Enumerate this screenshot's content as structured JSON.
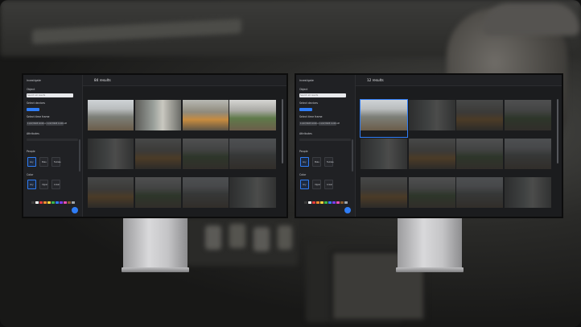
{
  "monitors": [
    {
      "id": "left",
      "panel_title": "Investigate",
      "results_title": "84 results",
      "search_label": "Object",
      "search_placeholder": "Search all results",
      "section_labels": [
        "Select devices",
        "Select time frame",
        "Attributes",
        "People",
        "Color"
      ],
      "time_chips": [
        "11/17/2023 10:00 AM",
        "11/17/2023 11:00 AM"
      ],
      "people_options": [
        "Any",
        "Male",
        "Female"
      ],
      "color_options": [
        "Any",
        "Upper",
        "Lower"
      ],
      "swatches": [
        "#3a3a3a",
        "#ffffff",
        "#e33b3b",
        "#f28b2f",
        "#f5d33b",
        "#3bb54a",
        "#2f7df6",
        "#7b3bf2",
        "#e84fb3",
        "#8b5a2b",
        "#9ea3a8"
      ]
    },
    {
      "id": "right",
      "panel_title": "Investigate",
      "results_title": "12 results",
      "search_label": "Object",
      "search_placeholder": "Search all results",
      "section_labels": [
        "Select devices",
        "Select time frame",
        "Attributes",
        "People",
        "Color"
      ],
      "time_chips": [
        "11/17/2023 10:00 AM",
        "11/17/2023 11:00 AM"
      ],
      "people_options": [
        "Any",
        "Male",
        "Female"
      ],
      "color_options": [
        "Any",
        "Upper",
        "Lower"
      ],
      "swatches": [
        "#3a3a3a",
        "#ffffff",
        "#e33b3b",
        "#f28b2f",
        "#f5d33b",
        "#3bb54a",
        "#2f7df6",
        "#7b3bf2",
        "#e84fb3",
        "#8b5a2b",
        "#9ea3a8"
      ]
    }
  ],
  "colors": {
    "accent": "#2f7df6",
    "screen_bg": "#1b1c1e",
    "panel_bg": "#202124"
  }
}
